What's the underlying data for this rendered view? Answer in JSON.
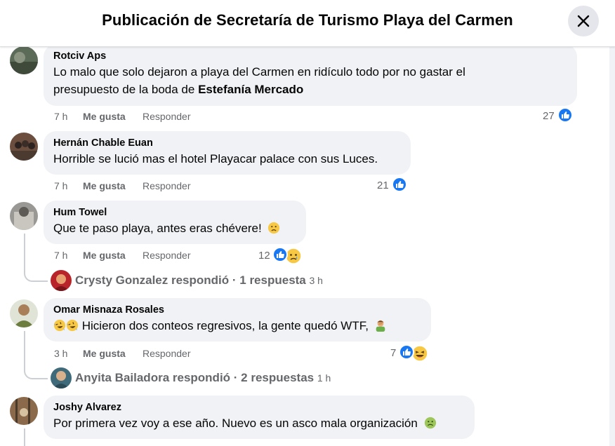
{
  "header": {
    "title": "Publicación de Secretaría de Turismo Playa del Carmen",
    "close_label": "close"
  },
  "comments": [
    {
      "author": "Rotciv Aps",
      "text_line1": "Lo malo que solo dejaron a playa del Carmen en ridículo todo por no gastar el",
      "text_line2_prefix": "presupuesto de la boda de ",
      "text_line2_mention": "Estefanía Mercado",
      "time": "7 h",
      "like": "Me gusta",
      "reply": "Responder",
      "reactions": "27",
      "reaction_icons": [
        "like-icon"
      ]
    },
    {
      "author": "Hernán Chable Euan",
      "text": "Horrible se lució mas el hotel Playacar palace con sus Luces.",
      "time": "7 h",
      "like": "Me gusta",
      "reply": "Responder",
      "reactions": "21",
      "reaction_icons": [
        "like-icon"
      ]
    },
    {
      "author": "Hum Towel",
      "text": "Que te paso playa, antes eras chévere!",
      "text_emoji": "frowning-face-emoji",
      "time": "7 h",
      "like": "Me gusta",
      "reply": "Responder",
      "reactions": "12",
      "reaction_icons": [
        "like-icon",
        "sad-icon"
      ],
      "replies": {
        "name": "Crysty Gonzalez",
        "verb": " respondió · ",
        "count": "1 respuesta",
        "time": "3 h"
      }
    },
    {
      "author": "Omar Misnaza Rosales",
      "text": "Hicieron dos conteos regresivos, la gente quedó WTF,",
      "text_emojis": [
        "rolling-laughing-emoji",
        "rolling-laughing-emoji",
        "man-facepalming-emoji"
      ],
      "time": "3 h",
      "like": "Me gusta",
      "reply": "Responder",
      "reactions": "7",
      "reaction_icons": [
        "like-icon",
        "haha-icon"
      ],
      "replies": {
        "name": "Anyita Bailadora",
        "verb": " respondió · ",
        "count": "2 respuestas",
        "time": "1 h"
      }
    },
    {
      "author": "Joshy Alvarez",
      "text": "Por primera vez voy a ese año. Nuevo es un asco mala organización",
      "text_emoji": "nauseated-face-emoji"
    }
  ],
  "colors": {
    "like_blue": "#1877f2",
    "bubble_bg": "#f0f2f5",
    "muted_text": "#65676b",
    "close_bg": "#e4e6eb"
  }
}
